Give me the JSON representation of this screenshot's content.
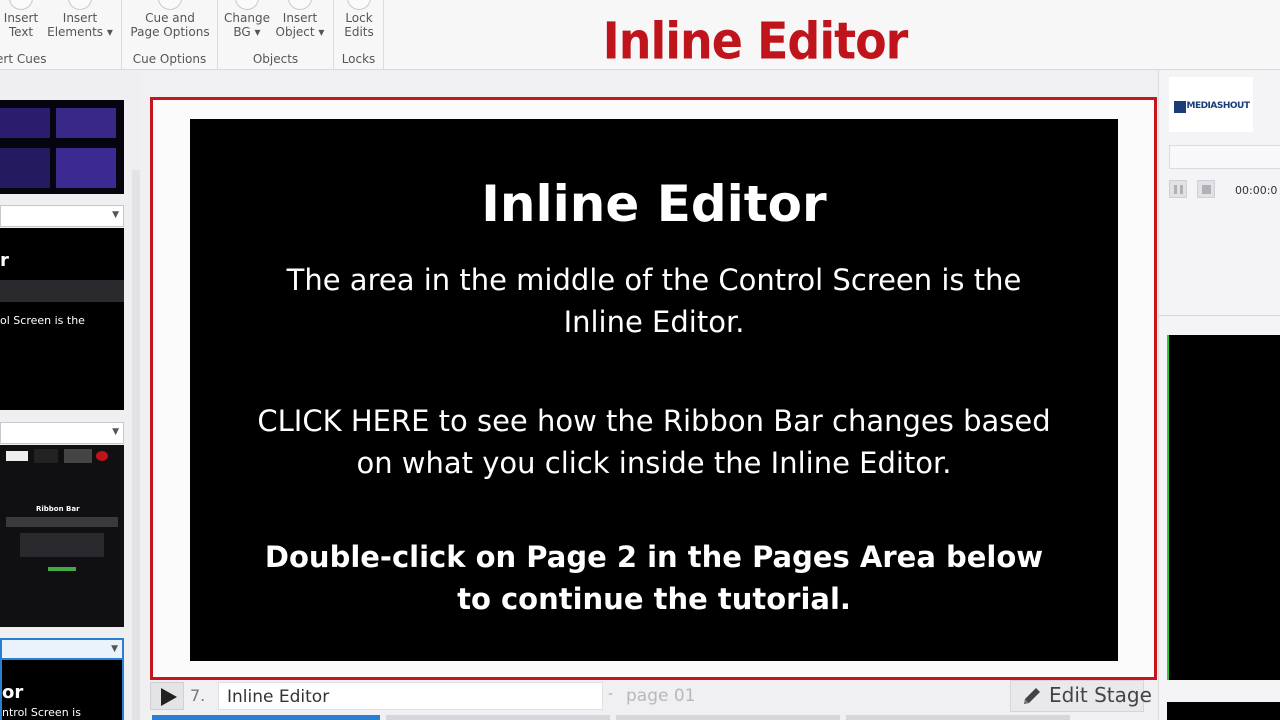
{
  "ribbon": {
    "groups": [
      {
        "name": "Insert Cues",
        "buttons": [
          {
            "label": "Insert\nText"
          },
          {
            "label": "Insert\nElements ▾"
          }
        ]
      },
      {
        "name": "Cue Options",
        "buttons": [
          {
            "label": "Cue and\nPage Options"
          }
        ]
      },
      {
        "name": "Objects",
        "buttons": [
          {
            "label": "Change\nBG ▾"
          },
          {
            "label": "Insert\nObject ▾"
          }
        ]
      },
      {
        "name": "Locks",
        "buttons": [
          {
            "label": "Lock\nEdits"
          }
        ]
      }
    ],
    "group_name_visible_first": "ert Cues"
  },
  "title_banner": "Inline Editor",
  "thumbnails": {
    "t2_title": "r",
    "t2_text": "ol Screen is the",
    "t3_title": "Ribbon Bar",
    "t4_title": "or",
    "t4_text": "ntrol Screen is"
  },
  "slide": {
    "title": "Inline Editor",
    "para1": "The area in the middle of the Control Screen is the Inline Editor.",
    "para2": "CLICK HERE to see how the Ribbon Bar changes based on what you click inside the Inline Editor.",
    "para3": "Double-click on Page 2 in the Pages Area below to continue the tutorial."
  },
  "bottom_bar": {
    "page_number": "7.",
    "page_name": "Inline Editor",
    "separator": "-",
    "page_id": "page 01",
    "edit_stage_label": "Edit Stage"
  },
  "right_panel": {
    "logo_text": "MEDIASHOUT",
    "timecode": "00:00:0"
  },
  "colors": {
    "accent_red": "#c4161c",
    "slide_bg": "#000000",
    "preview_border": "#36c43a"
  }
}
